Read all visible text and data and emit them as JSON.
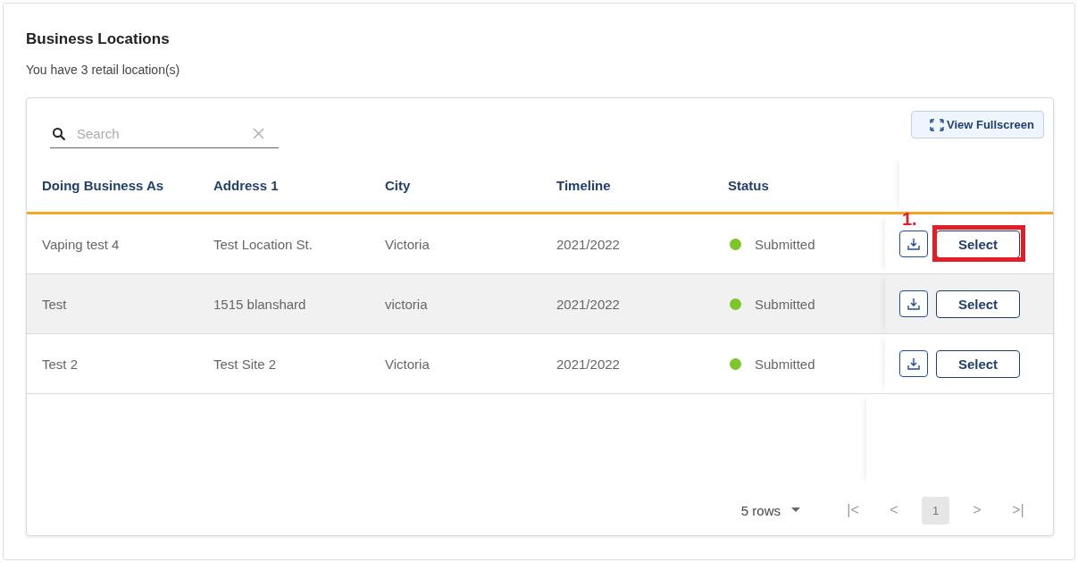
{
  "title": "Business Locations",
  "subtitle": "You have 3 retail location(s)",
  "search": {
    "placeholder": "Search"
  },
  "fullscreen_button": "View Fullscreen",
  "table": {
    "columns": [
      "Doing Business As",
      "Address 1",
      "City",
      "Timeline",
      "Status"
    ],
    "rows": [
      {
        "cells": [
          "Vaping test 4",
          "Test Location St.",
          "Victoria",
          "2021/2022"
        ],
        "status": "Submitted",
        "color": "#7cc62a",
        "action": "Select",
        "shaded": false,
        "annotation": "1."
      },
      {
        "cells": [
          "Test",
          "1515 blanshard",
          "victoria",
          "2021/2022"
        ],
        "status": "Submitted",
        "color": "#7cc62a",
        "action": "Select",
        "shaded": true
      },
      {
        "cells": [
          "Test 2",
          "Test Site 2",
          "Victoria",
          "2021/2022"
        ],
        "status": "Submitted",
        "color": "#7cc62a",
        "action": "Select",
        "shaded": false
      }
    ]
  },
  "pagination": {
    "rows_per_page": "5 rows",
    "first": "|<",
    "prev": "<",
    "next": ">",
    "last": ">|",
    "pages": [
      {
        "label": "1",
        "selected": true
      }
    ]
  }
}
